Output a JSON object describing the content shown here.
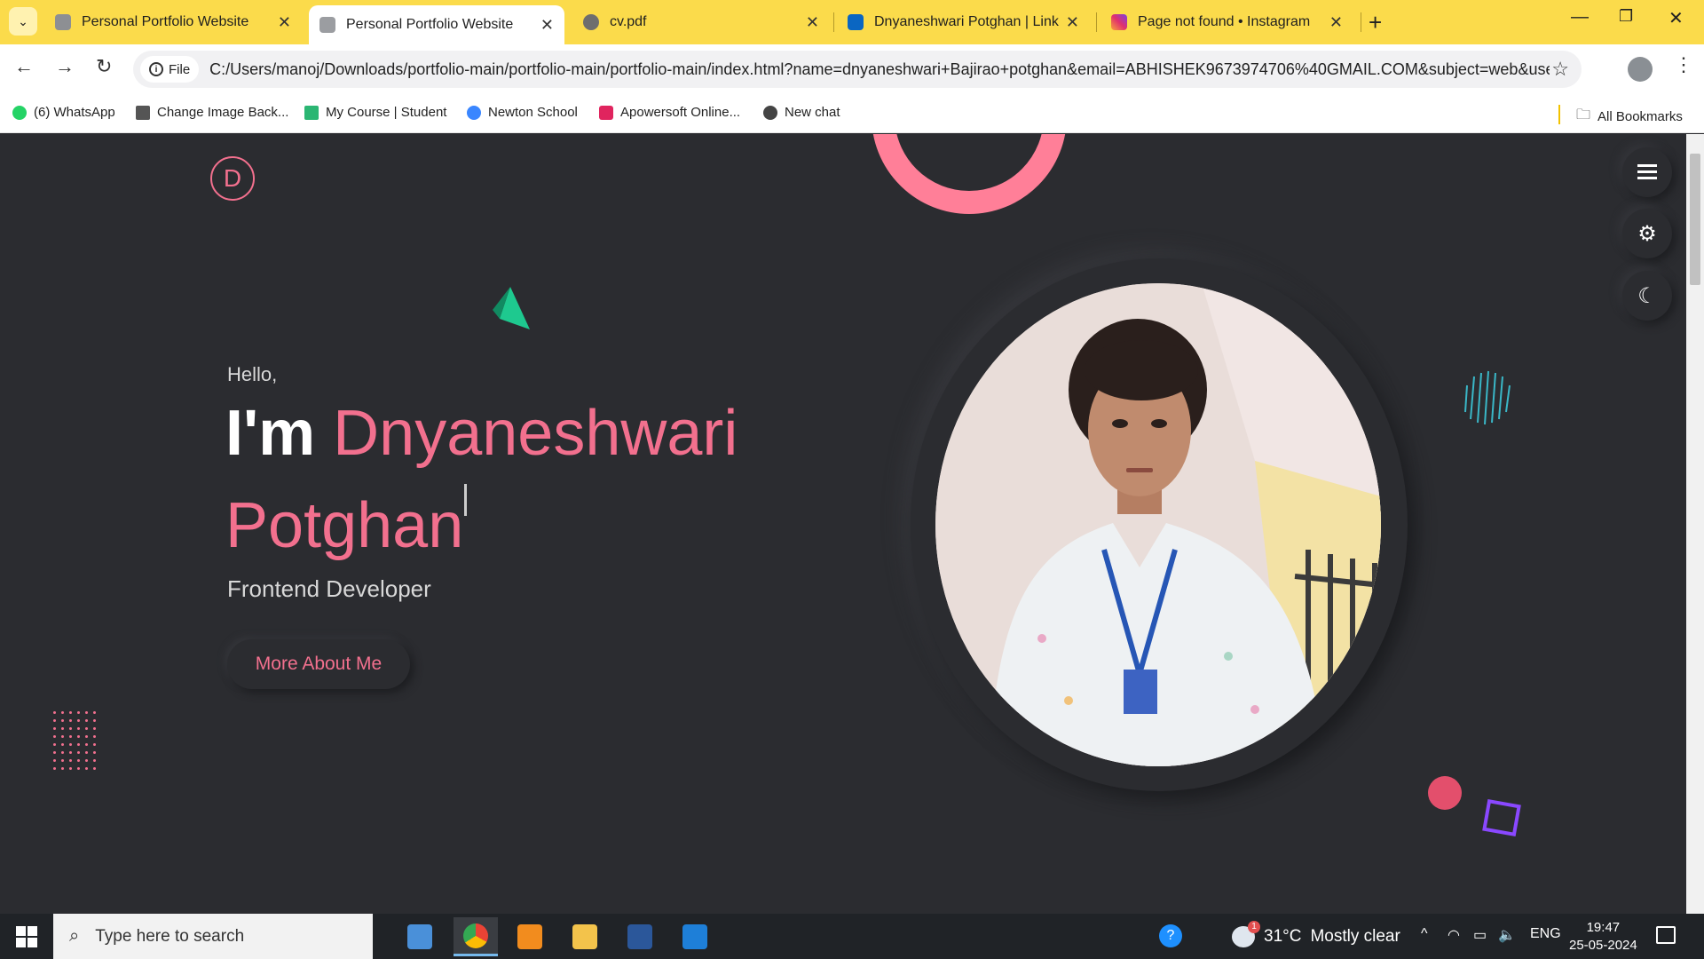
{
  "browser": {
    "tabs": [
      {
        "label": "Personal Portfolio Website",
        "active": false
      },
      {
        "label": "Personal Portfolio Website",
        "active": true
      },
      {
        "label": "cv.pdf",
        "active": false
      },
      {
        "label": "Dnyaneshwari Potghan | LinkedIn",
        "active": false
      },
      {
        "label": "Page not found • Instagram",
        "active": false
      }
    ],
    "url_chip": "File",
    "url": "C:/Users/manoj/Downloads/portfolio-main/portfolio-main/portfolio-main/index.html?name=dnyaneshwari+Bajirao+potghan&email=ABHISHEK9673974706%40GMAIL.COM&subject=web&user_dtl...",
    "bookmarks": [
      {
        "label": "(6) WhatsApp",
        "color": "#25d366"
      },
      {
        "label": "Change Image Back...",
        "color": "#555555"
      },
      {
        "label": "My Course | Student",
        "color": "#2bb673"
      },
      {
        "label": "Newton School",
        "color": "#3a86ff"
      },
      {
        "label": "Apowersoft Online...",
        "color": "#e0245e"
      },
      {
        "label": "New chat",
        "color": "#444444"
      }
    ],
    "all_bookmarks": "All Bookmarks"
  },
  "page": {
    "logo_letter": "D",
    "greeting": "Hello,",
    "iam": "I'm",
    "first_name": "Dnyaneshwari",
    "last_name": "Potghan",
    "role": "Frontend Developer",
    "cta": "More About Me",
    "accent": "#f2708e",
    "background": "#2b2c30"
  },
  "taskbar": {
    "search_placeholder": "Type here to search",
    "weather_temp": "31°C",
    "weather_text": "Mostly clear",
    "weather_badge": "1",
    "language": "ENG",
    "time": "19:47",
    "date": "25-05-2024"
  }
}
